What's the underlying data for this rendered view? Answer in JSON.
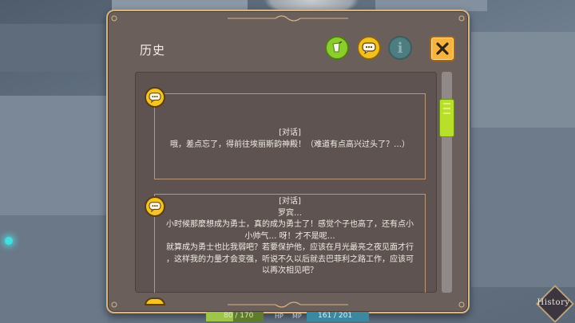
{
  "window": {
    "title": "历史",
    "info_glyph": "i"
  },
  "toolbar": {
    "voice_icon": "voice-replay-icon",
    "chat_icon": "chat-bubble-icon",
    "info_icon": "info-icon",
    "close_icon": "close-icon"
  },
  "entries": [
    {
      "tag": "[对话]",
      "lines": [
        "哦，差点忘了，得前往埃丽斯韵神殿！（难道有点高兴过头了？…）"
      ]
    },
    {
      "tag": "[对话]",
      "speaker": "罗宾…",
      "lines": [
        "小时候那麼想成为勇士，真的成为勇士了！感觉个子也高了，还有点小",
        "小帅气… 呀！才不是呢…",
        "就算成为勇士也比我弱吧？若要保护他，应该在月光最亮之夜见面才行",
        "，这样我的力量才会变强，听说不久以后就去巴菲利之路工作，应该可",
        "以再次相见吧？"
      ]
    }
  ],
  "hud": {
    "hp_text": "80 / 170",
    "hp_label": "HP",
    "mp_label": "MP",
    "mp_text": "161 / 201",
    "hp_fraction": 0.47
  },
  "history_button": {
    "label": "History"
  },
  "colors": {
    "panel": "#6b5f5b",
    "gold_border": "#d6b483",
    "bubble_yellow": "#f4c424",
    "voice_green": "#8ccd2e",
    "scroll_thumb": "#b8e02a"
  }
}
